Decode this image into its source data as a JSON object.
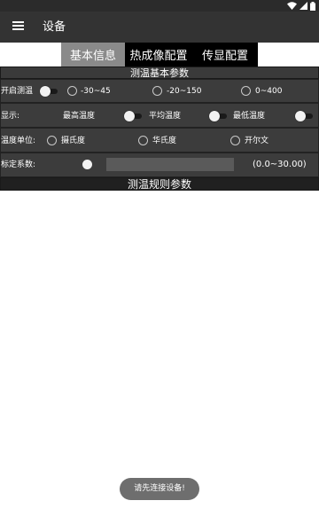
{
  "app_bar": {
    "title": "设备"
  },
  "tabs": [
    {
      "label": "基本信息",
      "active": true
    },
    {
      "label": "热成像配置",
      "active": false
    },
    {
      "label": "传显配置",
      "active": false
    }
  ],
  "basic_params": {
    "header": "测温基本参数",
    "enable_row": {
      "label": "开启测温",
      "switch_on": false,
      "range_options": [
        "-30~45",
        "-20~150",
        "0~400"
      ]
    },
    "display_row": {
      "label": "显示:",
      "toggles": [
        {
          "label": "最高温度",
          "on": false
        },
        {
          "label": "平均温度",
          "on": false
        },
        {
          "label": "最低温度",
          "on": false
        }
      ]
    },
    "unit_row": {
      "label": "温度单位:",
      "options": [
        "摄氏度",
        "华氏度",
        "开尔文"
      ]
    },
    "coef_row": {
      "label": "标定系数:",
      "range_text": "(0.0~30.00)"
    }
  },
  "rule_params": {
    "header": "测温规则参数"
  },
  "toast": {
    "text": "请先连接设备!"
  },
  "colors": {
    "app_bar": "#333333",
    "section_row": "#3c3c3c",
    "tab_active": "#8a8a8a",
    "tab_bg": "#000000",
    "toast": "#6e6e6e"
  }
}
